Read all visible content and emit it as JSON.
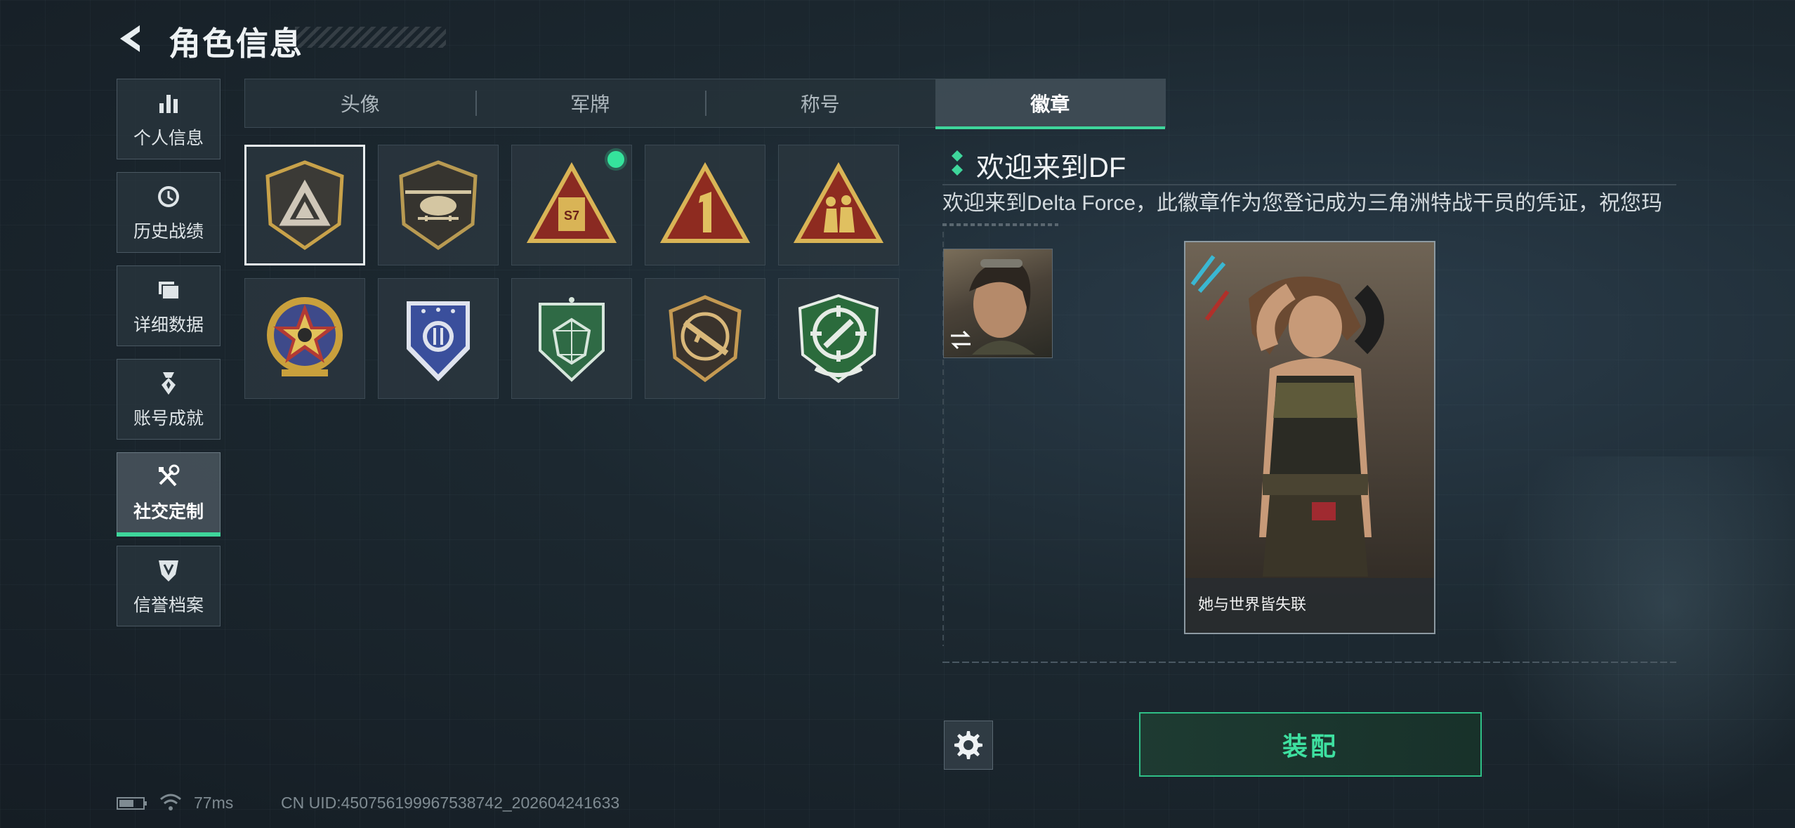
{
  "header": {
    "title": "角色信息",
    "back_icon": "back-arrow-icon"
  },
  "nav": {
    "items": [
      {
        "label": "个人信息",
        "icon": "bar-chart-icon"
      },
      {
        "label": "历史战绩",
        "icon": "history-clock-icon"
      },
      {
        "label": "详细数据",
        "icon": "folder-icon"
      },
      {
        "label": "账号成就",
        "icon": "medal-icon"
      },
      {
        "label": "社交定制",
        "icon": "tools-icon",
        "active": true
      },
      {
        "label": "信誉档案",
        "icon": "shield-emblem-icon"
      }
    ]
  },
  "tabs": [
    {
      "label": "头像"
    },
    {
      "label": "军牌"
    },
    {
      "label": "称号"
    },
    {
      "label": "徽章",
      "active": true
    }
  ],
  "badges": [
    {
      "icon": "delta-triangle-badge-icon",
      "selected": true
    },
    {
      "icon": "helicopter-badge-icon"
    },
    {
      "icon": "s7-triangle-badge-icon",
      "new": true
    },
    {
      "icon": "number-one-triangle-badge-icon"
    },
    {
      "icon": "soldiers-triangle-badge-icon"
    },
    {
      "icon": "star-skull-badge-icon"
    },
    {
      "icon": "blue-shield-badge-icon"
    },
    {
      "icon": "green-gem-badge-icon"
    },
    {
      "icon": "rifle-badge-icon"
    },
    {
      "icon": "green-crosshair-badge-icon"
    }
  ],
  "detail": {
    "title": "欢迎来到DF",
    "description": "欢迎来到Delta Force，此徽章作为您登记成为三角洲特战干员的凭证，祝您玛"
  },
  "card": {
    "caption": "她与世界皆失联"
  },
  "buttons": {
    "equip": "装配",
    "settings_icon": "gear-icon",
    "swap_icon": "swap-arrows-icon"
  },
  "status": {
    "ping": "77ms",
    "uid": "CN UID:450756199967538742_202604241633"
  },
  "colors": {
    "accent": "#3ed69b",
    "background": "#1c2830"
  }
}
